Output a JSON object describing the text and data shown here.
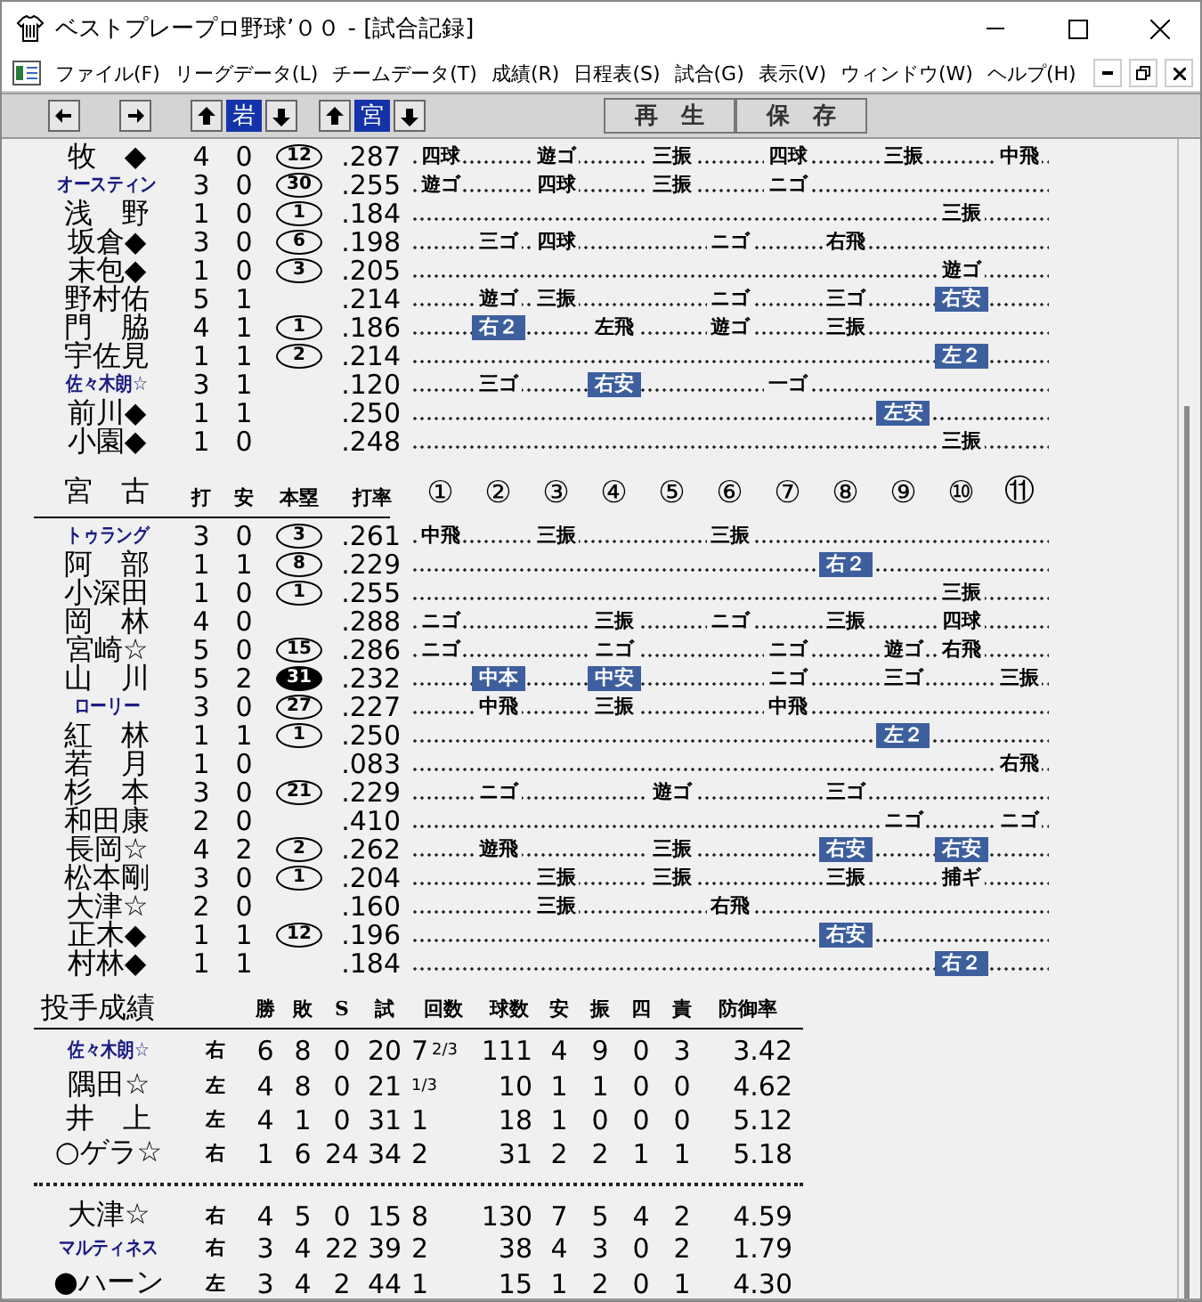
{
  "window": {
    "title": "ベストプレープロ野球’００ - [試合記録]"
  },
  "menu": [
    "ファイル(F)",
    "リーグデータ(L)",
    "チームデータ(T)",
    "成績(R)",
    "日程表(S)",
    "試合(G)",
    "表示(V)",
    "ウィンドウ(W)",
    "ヘルプ(H)"
  ],
  "toolbar": {
    "teams": [
      "岩",
      "宮"
    ],
    "buttons": [
      "再　生",
      "保　存"
    ]
  },
  "away_batting": {
    "rows": [
      {
        "name": "牧　◆",
        "narrow": false,
        "ab": "4",
        "h": "0",
        "hr": "12",
        "hr_filled": false,
        "avg": ".287",
        "results": [
          {
            "kind": "result",
            "text": "四球",
            "hit": false
          },
          {
            "kind": "none"
          },
          {
            "kind": "result",
            "text": "遊ゴ",
            "hit": false
          },
          {
            "kind": "none"
          },
          {
            "kind": "result",
            "text": "三振",
            "hit": false
          },
          {
            "kind": "none"
          },
          {
            "kind": "result",
            "text": "四球",
            "hit": false
          },
          {
            "kind": "none"
          },
          {
            "kind": "result",
            "text": "三振",
            "hit": false
          },
          {
            "kind": "none"
          },
          {
            "kind": "result",
            "text": "中飛",
            "hit": false
          }
        ]
      },
      {
        "name": "オースティン",
        "narrow": true,
        "ab": "3",
        "h": "0",
        "hr": "30",
        "hr_filled": false,
        "avg": ".255",
        "results": [
          {
            "kind": "result",
            "text": "遊ゴ",
            "hit": false
          },
          {
            "kind": "none"
          },
          {
            "kind": "result",
            "text": "四球",
            "hit": false
          },
          {
            "kind": "none"
          },
          {
            "kind": "result",
            "text": "三振",
            "hit": false
          },
          {
            "kind": "none"
          },
          {
            "kind": "result",
            "text": "ニゴ",
            "hit": false
          },
          {
            "kind": "none"
          },
          {
            "kind": "none"
          },
          {
            "kind": "none"
          },
          {
            "kind": "none"
          }
        ]
      },
      {
        "name": "浅　野",
        "narrow": false,
        "ab": "1",
        "h": "0",
        "hr": "1",
        "hr_filled": false,
        "avg": ".184",
        "results": [
          {
            "kind": "none"
          },
          {
            "kind": "none"
          },
          {
            "kind": "none"
          },
          {
            "kind": "none"
          },
          {
            "kind": "none"
          },
          {
            "kind": "none"
          },
          {
            "kind": "none"
          },
          {
            "kind": "none"
          },
          {
            "kind": "none"
          },
          {
            "kind": "result",
            "text": "三振",
            "hit": false
          },
          {
            "kind": "none"
          }
        ]
      },
      {
        "name": "坂倉◆",
        "narrow": false,
        "ab": "3",
        "h": "0",
        "hr": "6",
        "hr_filled": false,
        "avg": ".198",
        "results": [
          {
            "kind": "none"
          },
          {
            "kind": "result",
            "text": "三ゴ",
            "hit": false
          },
          {
            "kind": "result",
            "text": "四球",
            "hit": false
          },
          {
            "kind": "none"
          },
          {
            "kind": "none"
          },
          {
            "kind": "result",
            "text": "ニゴ",
            "hit": false
          },
          {
            "kind": "none"
          },
          {
            "kind": "result",
            "text": "右飛",
            "hit": false
          },
          {
            "kind": "none"
          },
          {
            "kind": "none"
          },
          {
            "kind": "none"
          }
        ]
      },
      {
        "name": "末包◆",
        "narrow": false,
        "ab": "1",
        "h": "0",
        "hr": "3",
        "hr_filled": false,
        "avg": ".205",
        "results": [
          {
            "kind": "none"
          },
          {
            "kind": "none"
          },
          {
            "kind": "none"
          },
          {
            "kind": "none"
          },
          {
            "kind": "none"
          },
          {
            "kind": "none"
          },
          {
            "kind": "none"
          },
          {
            "kind": "none"
          },
          {
            "kind": "none"
          },
          {
            "kind": "result",
            "text": "遊ゴ",
            "hit": false
          },
          {
            "kind": "none"
          }
        ]
      },
      {
        "name": "野村佑",
        "narrow": false,
        "ab": "5",
        "h": "1",
        "avg": ".214",
        "results": [
          {
            "kind": "none"
          },
          {
            "kind": "result",
            "text": "遊ゴ",
            "hit": false
          },
          {
            "kind": "result",
            "text": "三振",
            "hit": false
          },
          {
            "kind": "none"
          },
          {
            "kind": "none"
          },
          {
            "kind": "result",
            "text": "ニゴ",
            "hit": false
          },
          {
            "kind": "none"
          },
          {
            "kind": "result",
            "text": "三ゴ",
            "hit": false
          },
          {
            "kind": "none"
          },
          {
            "kind": "result",
            "text": "右安",
            "hit": true
          },
          {
            "kind": "none"
          }
        ]
      },
      {
        "name": "門　脇",
        "narrow": false,
        "ab": "4",
        "h": "1",
        "hr": "1",
        "hr_filled": false,
        "avg": ".186",
        "results": [
          {
            "kind": "none"
          },
          {
            "kind": "result",
            "text": "右２",
            "hit": true
          },
          {
            "kind": "none"
          },
          {
            "kind": "result",
            "text": "左飛",
            "hit": false
          },
          {
            "kind": "none"
          },
          {
            "kind": "result",
            "text": "遊ゴ",
            "hit": false
          },
          {
            "kind": "none"
          },
          {
            "kind": "result",
            "text": "三振",
            "hit": false
          },
          {
            "kind": "none"
          },
          {
            "kind": "none"
          },
          {
            "kind": "none"
          }
        ]
      },
      {
        "name": "宇佐見",
        "narrow": false,
        "ab": "1",
        "h": "1",
        "hr": "2",
        "hr_filled": false,
        "avg": ".214",
        "results": [
          {
            "kind": "none"
          },
          {
            "kind": "none"
          },
          {
            "kind": "none"
          },
          {
            "kind": "none"
          },
          {
            "kind": "none"
          },
          {
            "kind": "none"
          },
          {
            "kind": "none"
          },
          {
            "kind": "none"
          },
          {
            "kind": "none"
          },
          {
            "kind": "result",
            "text": "左２",
            "hit": true
          },
          {
            "kind": "none"
          }
        ]
      },
      {
        "name": "佐々木朗☆",
        "narrow": true,
        "ab": "3",
        "h": "1",
        "avg": ".120",
        "results": [
          {
            "kind": "none"
          },
          {
            "kind": "result",
            "text": "三ゴ",
            "hit": false
          },
          {
            "kind": "none"
          },
          {
            "kind": "result",
            "text": "右安",
            "hit": true
          },
          {
            "kind": "none"
          },
          {
            "kind": "none"
          },
          {
            "kind": "result",
            "text": "一ゴ",
            "hit": false
          },
          {
            "kind": "none"
          },
          {
            "kind": "none"
          },
          {
            "kind": "none"
          },
          {
            "kind": "none"
          }
        ]
      },
      {
        "name": "前川◆",
        "narrow": false,
        "ab": "1",
        "h": "1",
        "avg": ".250",
        "results": [
          {
            "kind": "none"
          },
          {
            "kind": "none"
          },
          {
            "kind": "none"
          },
          {
            "kind": "none"
          },
          {
            "kind": "none"
          },
          {
            "kind": "none"
          },
          {
            "kind": "none"
          },
          {
            "kind": "none"
          },
          {
            "kind": "result",
            "text": "左安",
            "hit": true
          },
          {
            "kind": "none"
          },
          {
            "kind": "none"
          }
        ]
      },
      {
        "name": "小園◆",
        "narrow": false,
        "ab": "1",
        "h": "0",
        "avg": ".248",
        "results": [
          {
            "kind": "none"
          },
          {
            "kind": "none"
          },
          {
            "kind": "none"
          },
          {
            "kind": "none"
          },
          {
            "kind": "none"
          },
          {
            "kind": "none"
          },
          {
            "kind": "none"
          },
          {
            "kind": "none"
          },
          {
            "kind": "none"
          },
          {
            "kind": "result",
            "text": "三振",
            "hit": false
          },
          {
            "kind": "none"
          }
        ]
      }
    ]
  },
  "home_batting": {
    "team": "宮　古",
    "columns": [
      "打",
      "安",
      "本塁",
      "打率"
    ],
    "innings": [
      "①",
      "②",
      "③",
      "④",
      "⑤",
      "⑥",
      "⑦",
      "⑧",
      "⑨",
      "⑩",
      "⑪"
    ],
    "rows": [
      {
        "name": "トゥラング",
        "narrow": true,
        "ab": "3",
        "h": "0",
        "hr": "3",
        "hr_filled": false,
        "avg": ".261",
        "results": [
          {
            "kind": "result",
            "text": "中飛",
            "hit": false
          },
          {
            "kind": "none"
          },
          {
            "kind": "result",
            "text": "三振",
            "hit": false
          },
          {
            "kind": "none"
          },
          {
            "kind": "none"
          },
          {
            "kind": "result",
            "text": "三振",
            "hit": false
          },
          {
            "kind": "none"
          },
          {
            "kind": "none"
          },
          {
            "kind": "none"
          },
          {
            "kind": "none"
          },
          {
            "kind": "none"
          }
        ]
      },
      {
        "name": "阿　部",
        "narrow": false,
        "ab": "1",
        "h": "1",
        "hr": "8",
        "hr_filled": false,
        "avg": ".229",
        "results": [
          {
            "kind": "none"
          },
          {
            "kind": "none"
          },
          {
            "kind": "none"
          },
          {
            "kind": "none"
          },
          {
            "kind": "none"
          },
          {
            "kind": "none"
          },
          {
            "kind": "none"
          },
          {
            "kind": "result",
            "text": "右２",
            "hit": true
          },
          {
            "kind": "none"
          },
          {
            "kind": "none"
          },
          {
            "kind": "none"
          }
        ]
      },
      {
        "name": "小深田",
        "narrow": false,
        "ab": "1",
        "h": "0",
        "hr": "1",
        "hr_filled": false,
        "avg": ".255",
        "results": [
          {
            "kind": "none"
          },
          {
            "kind": "none"
          },
          {
            "kind": "none"
          },
          {
            "kind": "none"
          },
          {
            "kind": "none"
          },
          {
            "kind": "none"
          },
          {
            "kind": "none"
          },
          {
            "kind": "none"
          },
          {
            "kind": "none"
          },
          {
            "kind": "result",
            "text": "三振",
            "hit": false
          },
          {
            "kind": "none"
          }
        ]
      },
      {
        "name": "岡　林",
        "narrow": false,
        "ab": "4",
        "h": "0",
        "avg": ".288",
        "results": [
          {
            "kind": "result",
            "text": "ニゴ",
            "hit": false
          },
          {
            "kind": "none"
          },
          {
            "kind": "none"
          },
          {
            "kind": "result",
            "text": "三振",
            "hit": false
          },
          {
            "kind": "none"
          },
          {
            "kind": "result",
            "text": "ニゴ",
            "hit": false
          },
          {
            "kind": "none"
          },
          {
            "kind": "result",
            "text": "三振",
            "hit": false
          },
          {
            "kind": "none"
          },
          {
            "kind": "result",
            "text": "四球",
            "hit": false
          },
          {
            "kind": "none"
          }
        ]
      },
      {
        "name": "宮崎☆",
        "narrow": false,
        "ab": "5",
        "h": "0",
        "hr": "15",
        "hr_filled": false,
        "avg": ".286",
        "results": [
          {
            "kind": "result",
            "text": "ニゴ",
            "hit": false
          },
          {
            "kind": "none"
          },
          {
            "kind": "none"
          },
          {
            "kind": "result",
            "text": "ニゴ",
            "hit": false
          },
          {
            "kind": "none"
          },
          {
            "kind": "none"
          },
          {
            "kind": "result",
            "text": "ニゴ",
            "hit": false
          },
          {
            "kind": "none"
          },
          {
            "kind": "result",
            "text": "遊ゴ",
            "hit": false
          },
          {
            "kind": "result",
            "text": "右飛",
            "hit": false
          },
          {
            "kind": "none"
          }
        ]
      },
      {
        "name": "山　川",
        "narrow": false,
        "ab": "5",
        "h": "2",
        "hr": "31",
        "hr_filled": true,
        "avg": ".232",
        "results": [
          {
            "kind": "none"
          },
          {
            "kind": "result",
            "text": "中本",
            "hit": true
          },
          {
            "kind": "none"
          },
          {
            "kind": "result",
            "text": "中安",
            "hit": true
          },
          {
            "kind": "none"
          },
          {
            "kind": "none"
          },
          {
            "kind": "result",
            "text": "ニゴ",
            "hit": false
          },
          {
            "kind": "none"
          },
          {
            "kind": "result",
            "text": "三ゴ",
            "hit": false
          },
          {
            "kind": "none"
          },
          {
            "kind": "result",
            "text": "三振",
            "hit": false
          }
        ]
      },
      {
        "name": "ローリー",
        "narrow": true,
        "ab": "3",
        "h": "0",
        "hr": "27",
        "hr_filled": false,
        "avg": ".227",
        "results": [
          {
            "kind": "none"
          },
          {
            "kind": "result",
            "text": "中飛",
            "hit": false
          },
          {
            "kind": "none"
          },
          {
            "kind": "result",
            "text": "三振",
            "hit": false
          },
          {
            "kind": "none"
          },
          {
            "kind": "none"
          },
          {
            "kind": "result",
            "text": "中飛",
            "hit": false
          },
          {
            "kind": "none"
          },
          {
            "kind": "none"
          },
          {
            "kind": "none"
          },
          {
            "kind": "none"
          }
        ]
      },
      {
        "name": "紅　林",
        "narrow": false,
        "ab": "1",
        "h": "1",
        "hr": "1",
        "hr_filled": false,
        "avg": ".250",
        "results": [
          {
            "kind": "none"
          },
          {
            "kind": "none"
          },
          {
            "kind": "none"
          },
          {
            "kind": "none"
          },
          {
            "kind": "none"
          },
          {
            "kind": "none"
          },
          {
            "kind": "none"
          },
          {
            "kind": "none"
          },
          {
            "kind": "result",
            "text": "左２",
            "hit": true
          },
          {
            "kind": "none"
          },
          {
            "kind": "none"
          }
        ]
      },
      {
        "name": "若　月",
        "narrow": false,
        "ab": "1",
        "h": "0",
        "avg": ".083",
        "results": [
          {
            "kind": "none"
          },
          {
            "kind": "none"
          },
          {
            "kind": "none"
          },
          {
            "kind": "none"
          },
          {
            "kind": "none"
          },
          {
            "kind": "none"
          },
          {
            "kind": "none"
          },
          {
            "kind": "none"
          },
          {
            "kind": "none"
          },
          {
            "kind": "none"
          },
          {
            "kind": "result",
            "text": "右飛",
            "hit": false
          }
        ]
      },
      {
        "name": "杉　本",
        "narrow": false,
        "ab": "3",
        "h": "0",
        "hr": "21",
        "hr_filled": false,
        "avg": ".229",
        "results": [
          {
            "kind": "none"
          },
          {
            "kind": "result",
            "text": "ニゴ",
            "hit": false
          },
          {
            "kind": "none"
          },
          {
            "kind": "none"
          },
          {
            "kind": "result",
            "text": "遊ゴ",
            "hit": false
          },
          {
            "kind": "none"
          },
          {
            "kind": "none"
          },
          {
            "kind": "result",
            "text": "三ゴ",
            "hit": false
          },
          {
            "kind": "none"
          },
          {
            "kind": "none"
          },
          {
            "kind": "none"
          }
        ]
      },
      {
        "name": "和田康",
        "narrow": false,
        "ab": "2",
        "h": "0",
        "avg": ".410",
        "results": [
          {
            "kind": "none"
          },
          {
            "kind": "none"
          },
          {
            "kind": "none"
          },
          {
            "kind": "none"
          },
          {
            "kind": "none"
          },
          {
            "kind": "none"
          },
          {
            "kind": "none"
          },
          {
            "kind": "none"
          },
          {
            "kind": "result",
            "text": "ニゴ",
            "hit": false
          },
          {
            "kind": "none"
          },
          {
            "kind": "result",
            "text": "ニゴ",
            "hit": false
          }
        ]
      },
      {
        "name": "長岡☆",
        "narrow": false,
        "ab": "4",
        "h": "2",
        "hr": "2",
        "hr_filled": false,
        "avg": ".262",
        "results": [
          {
            "kind": "none"
          },
          {
            "kind": "result",
            "text": "遊飛",
            "hit": false
          },
          {
            "kind": "none"
          },
          {
            "kind": "none"
          },
          {
            "kind": "result",
            "text": "三振",
            "hit": false
          },
          {
            "kind": "none"
          },
          {
            "kind": "none"
          },
          {
            "kind": "result",
            "text": "右安",
            "hit": true
          },
          {
            "kind": "none"
          },
          {
            "kind": "result",
            "text": "右安",
            "hit": true
          },
          {
            "kind": "none"
          }
        ]
      },
      {
        "name": "松本剛",
        "narrow": false,
        "ab": "3",
        "h": "0",
        "hr": "1",
        "hr_filled": false,
        "avg": ".204",
        "results": [
          {
            "kind": "none"
          },
          {
            "kind": "none"
          },
          {
            "kind": "result",
            "text": "三振",
            "hit": false
          },
          {
            "kind": "none"
          },
          {
            "kind": "result",
            "text": "三振",
            "hit": false
          },
          {
            "kind": "none"
          },
          {
            "kind": "none"
          },
          {
            "kind": "result",
            "text": "三振",
            "hit": false
          },
          {
            "kind": "none"
          },
          {
            "kind": "result",
            "text": "捕ギ",
            "hit": false
          },
          {
            "kind": "none"
          }
        ]
      },
      {
        "name": "大津☆",
        "narrow": false,
        "ab": "2",
        "h": "0",
        "avg": ".160",
        "results": [
          {
            "kind": "none"
          },
          {
            "kind": "none"
          },
          {
            "kind": "result",
            "text": "三振",
            "hit": false
          },
          {
            "kind": "none"
          },
          {
            "kind": "none"
          },
          {
            "kind": "result",
            "text": "右飛",
            "hit": false
          },
          {
            "kind": "none"
          },
          {
            "kind": "none"
          },
          {
            "kind": "none"
          },
          {
            "kind": "none"
          },
          {
            "kind": "none"
          }
        ]
      },
      {
        "name": "正木◆",
        "narrow": false,
        "ab": "1",
        "h": "1",
        "hr": "12",
        "hr_filled": false,
        "avg": ".196",
        "results": [
          {
            "kind": "none"
          },
          {
            "kind": "none"
          },
          {
            "kind": "none"
          },
          {
            "kind": "none"
          },
          {
            "kind": "none"
          },
          {
            "kind": "none"
          },
          {
            "kind": "none"
          },
          {
            "kind": "result",
            "text": "右安",
            "hit": true
          },
          {
            "kind": "none"
          },
          {
            "kind": "none"
          },
          {
            "kind": "none"
          }
        ]
      },
      {
        "name": "村林◆",
        "narrow": false,
        "ab": "1",
        "h": "1",
        "avg": ".184",
        "results": [
          {
            "kind": "none"
          },
          {
            "kind": "none"
          },
          {
            "kind": "none"
          },
          {
            "kind": "none"
          },
          {
            "kind": "none"
          },
          {
            "kind": "none"
          },
          {
            "kind": "none"
          },
          {
            "kind": "none"
          },
          {
            "kind": "none"
          },
          {
            "kind": "result",
            "text": "右２",
            "hit": true
          },
          {
            "kind": "none"
          }
        ]
      }
    ]
  },
  "pitching": {
    "title": "投手成績",
    "columns": [
      "勝",
      "敗",
      "S",
      "試",
      "回数",
      "球数",
      "安",
      "振",
      "四",
      "責",
      "防御率"
    ],
    "groups": [
      [
        {
          "name": "佐々木朗☆",
          "narrow": true,
          "hand": "右",
          "w": "6",
          "l": "8",
          "s": "0",
          "g": "20",
          "ip": "7",
          "ip_frac": "2/3",
          "np": "111",
          "ha": "4",
          "so": "9",
          "bb": "0",
          "er": "3",
          "era": "3.42"
        },
        {
          "name": "隅田☆",
          "narrow": false,
          "hand": "左",
          "w": "4",
          "l": "8",
          "s": "0",
          "g": "21",
          "ip_frac": "1/3",
          "np": "10",
          "ha": "1",
          "so": "1",
          "bb": "0",
          "er": "0",
          "era": "4.62"
        },
        {
          "name": "井　上",
          "narrow": false,
          "hand": "左",
          "w": "4",
          "l": "1",
          "s": "0",
          "g": "31",
          "ip": "1",
          "np": "18",
          "ha": "1",
          "so": "0",
          "bb": "0",
          "er": "0",
          "era": "5.12"
        },
        {
          "name": "○ゲラ☆",
          "narrow": false,
          "hand": "右",
          "w": "1",
          "l": "6",
          "s": "24",
          "g": "34",
          "ip": "2",
          "np": "31",
          "ha": "2",
          "so": "2",
          "bb": "1",
          "er": "1",
          "era": "5.18"
        }
      ],
      [
        {
          "name": "大津☆",
          "narrow": false,
          "hand": "右",
          "w": "4",
          "l": "5",
          "s": "0",
          "g": "15",
          "ip": "8",
          "np": "130",
          "ha": "7",
          "so": "5",
          "bb": "4",
          "er": "2",
          "era": "4.59"
        },
        {
          "name": "マルティネス",
          "narrow": true,
          "hand": "右",
          "w": "3",
          "l": "4",
          "s": "22",
          "g": "39",
          "ip": "2",
          "np": "38",
          "ha": "4",
          "so": "3",
          "bb": "0",
          "er": "2",
          "era": "1.79"
        },
        {
          "name": "●ハーン",
          "narrow": false,
          "hand": "左",
          "w": "3",
          "l": "4",
          "s": "2",
          "g": "44",
          "ip": "1",
          "np": "15",
          "ha": "1",
          "so": "2",
          "bb": "0",
          "er": "1",
          "era": "4.30"
        }
      ]
    ]
  }
}
